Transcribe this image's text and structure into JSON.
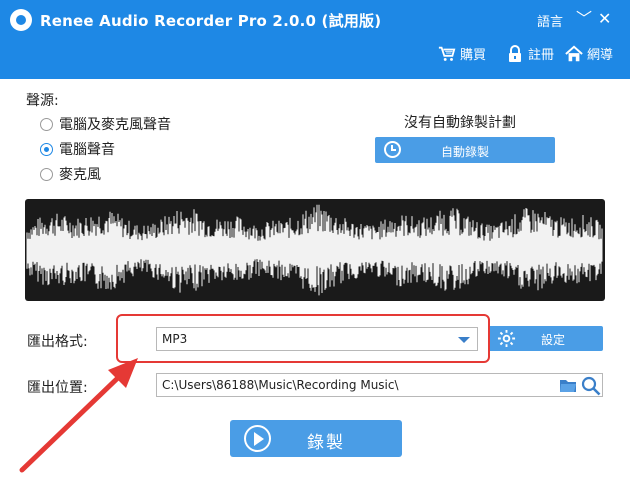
{
  "window": {
    "title": "Renee Audio Recorder Pro 2.0.0 (試用版)",
    "language_label": "語言",
    "minimize_glyph": "﹀",
    "close_glyph": "✕"
  },
  "top_nav": {
    "buy": {
      "label": "購買",
      "icon": "cart-icon"
    },
    "register": {
      "label": "註冊",
      "icon": "lock-icon"
    },
    "home": {
      "label": "網導",
      "icon": "home-icon"
    }
  },
  "source": {
    "label": "聲源:",
    "options": [
      {
        "label": "電腦及麥克風聲音",
        "checked": false
      },
      {
        "label": "電腦聲音",
        "checked": true
      },
      {
        "label": "麥克風",
        "checked": false
      }
    ]
  },
  "schedule": {
    "status": "沒有自動錄製計劃",
    "button_label": "自動錄製"
  },
  "format": {
    "label": "匯出格式:",
    "value": "MP3",
    "settings_label": "設定"
  },
  "location": {
    "label": "匯出位置:",
    "value": "C:\\Users\\86188\\Music\\Recording Music\\"
  },
  "record": {
    "label": "錄製"
  },
  "colors": {
    "titlebar": "#1e88e5",
    "button": "#4a9de6",
    "annotation": "#e53935",
    "waveform_bg": "#1a1a1a"
  }
}
